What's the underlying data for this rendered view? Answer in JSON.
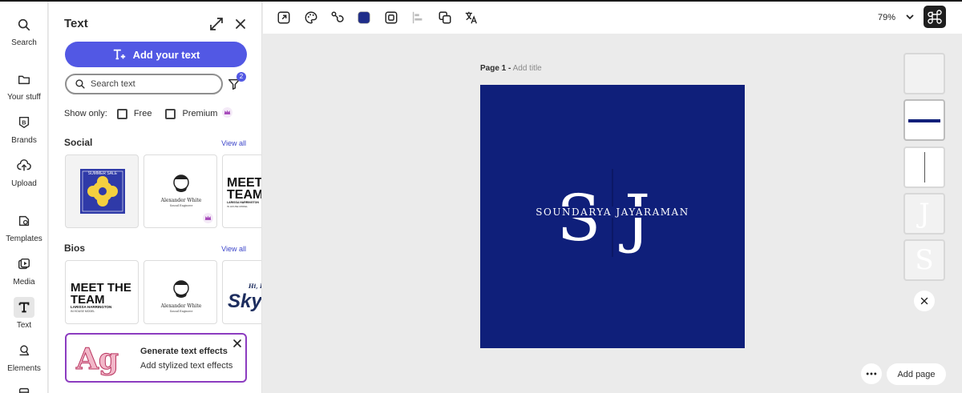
{
  "rail": {
    "items": [
      {
        "label": "Search",
        "icon": "search-icon"
      },
      {
        "label": "Your stuff",
        "icon": "folder-icon"
      },
      {
        "label": "Brands",
        "icon": "brand-icon"
      },
      {
        "label": "Upload",
        "icon": "upload-icon"
      },
      {
        "label": "Templates",
        "icon": "templates-icon"
      },
      {
        "label": "Media",
        "icon": "media-icon"
      },
      {
        "label": "Text",
        "icon": "text-icon"
      },
      {
        "label": "Elements",
        "icon": "elements-icon"
      }
    ],
    "active": "Text"
  },
  "panel": {
    "title": "Text",
    "add_text_label": "Add your text",
    "search_placeholder": "Search text",
    "filter_count": "2",
    "show_only_label": "Show only:",
    "filter_free": "Free",
    "filter_premium": "Premium",
    "sections": [
      {
        "title": "Social",
        "view_all": "View all"
      },
      {
        "title": "Bios",
        "view_all": "View all"
      }
    ],
    "thumb_text": {
      "summer_sale": "SUMMER SALE",
      "name": "Alexander White",
      "role": "Sound Engineer",
      "meet": "MEET",
      "team": "TEAM",
      "meet_the": "MEET THE",
      "larissa": "LARISSA HARRINGTON",
      "in_house": "IN HOUSE MODEL",
      "hi": "Hi, I",
      "sky": "Sky"
    },
    "gen_card": {
      "sample": "Ag",
      "title": "Generate text effects",
      "subtitle": "Add stylized text effects"
    }
  },
  "toolbar": {
    "zoom": "79%"
  },
  "canvas": {
    "page_label": "Page 1 -",
    "add_title": "Add title",
    "design": {
      "letter_left": "S",
      "letter_right": "J",
      "name": "SOUNDARYA JAYARAMAN",
      "background": "#0f1f7a"
    },
    "side_thumbs": {
      "j": "J",
      "s": "S"
    },
    "add_page_label": "Add page"
  },
  "colors": {
    "accent": "#5258e4",
    "gen_border": "#8c3cc0",
    "link": "#3b44c9"
  }
}
